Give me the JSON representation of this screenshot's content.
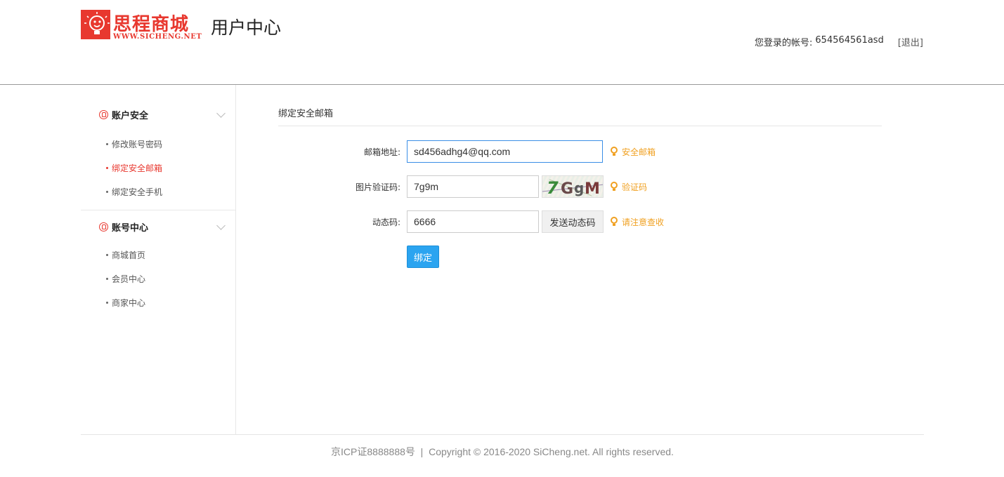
{
  "header": {
    "logo_cn": "思程商城",
    "logo_en": "WWW.SICHENG.NET",
    "title": "用户中心",
    "account_label": "您登录的帐号:",
    "account_id": "654564561asd",
    "logout": "[退出]"
  },
  "sidebar": {
    "groups": [
      {
        "title": "账户安全",
        "items": [
          {
            "label": "修改账号密码",
            "active": false
          },
          {
            "label": "绑定安全邮箱",
            "active": true
          },
          {
            "label": "绑定安全手机",
            "active": false
          }
        ]
      },
      {
        "title": "账号中心",
        "items": [
          {
            "label": "商城首页",
            "active": false
          },
          {
            "label": "会员中心",
            "active": false
          },
          {
            "label": "商家中心",
            "active": false
          }
        ]
      }
    ]
  },
  "main": {
    "section_title": "绑定安全邮箱",
    "email": {
      "label": "邮箱地址:",
      "value": "sd456adhg4@qq.com",
      "hint": "安全邮箱"
    },
    "captcha": {
      "label": "图片验证码:",
      "value": "7g9m",
      "image_text": "7GgM",
      "hint": "验证码"
    },
    "dynamic": {
      "label": "动态码:",
      "value": "6666",
      "send_button": "发送动态码",
      "hint": "请注意查收"
    },
    "bind_button": "绑定"
  },
  "footer": {
    "text": "京ICP证8888888号  |  Copyright © 2016-2020 SiCheng.net. All rights reserved."
  },
  "colors": {
    "brand": "#e8382f",
    "hint": "#f0a020",
    "primary_button": "#2ba4f0",
    "focus_border": "#3a8ee6"
  }
}
